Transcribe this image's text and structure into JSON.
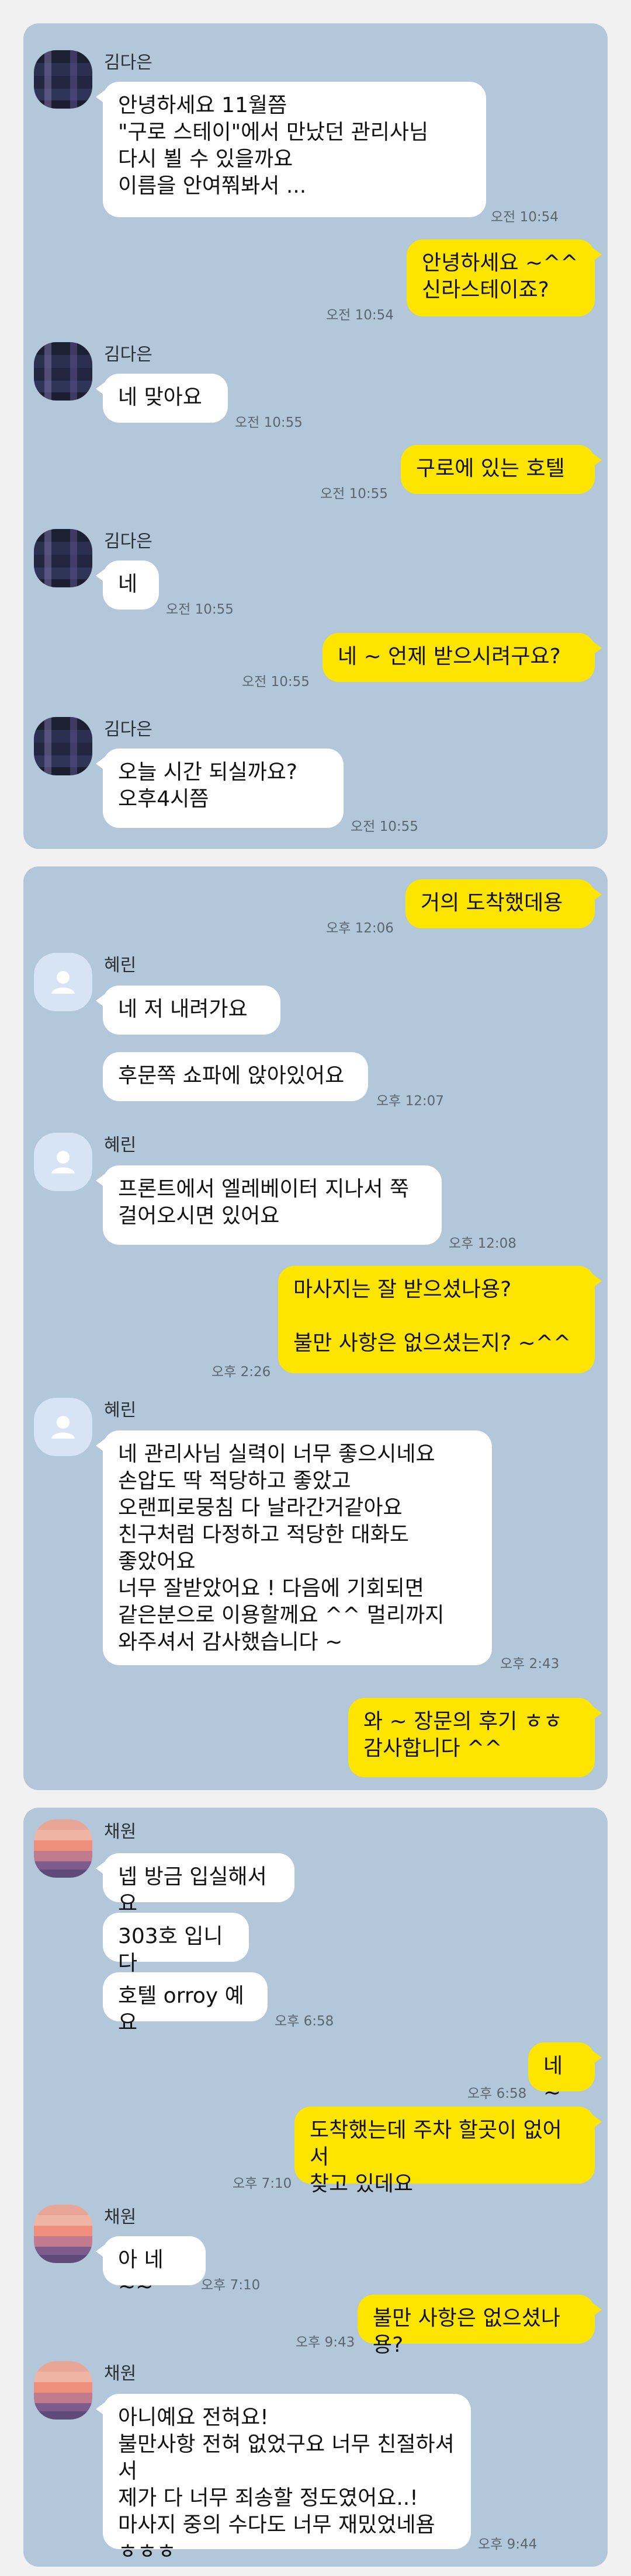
{
  "chat1": {
    "sender": "김다은",
    "m1_text": "안녕하세요 11월쯤\n\"구로 스테이\"에서 만났던 관리사님\n다시 뵐 수 있을까요\n이름을 안여쭤봐서 ...",
    "m1_time": "오전 10:54",
    "m2_text": "안녕하세요 ~^^\n신라스테이죠?",
    "m2_time": "오전 10:54",
    "m3_text": "네 맞아요",
    "m3_time": "오전 10:55",
    "m4_text": "구로에 있는 호텔",
    "m4_time": "오전 10:55",
    "m5_text": "네",
    "m5_time": "오전 10:55",
    "m6_text": "네 ~ 언제 받으시려구요?",
    "m6_time": "오전 10:55",
    "m7_text": "오늘  시간 되실까요?\n오후4시쯤",
    "m7_time": "오전 10:55"
  },
  "chat2": {
    "sender": "혜린",
    "m1_text": "거의 도착했데용",
    "m1_time": "오후 12:06",
    "m2_text": "네 저 내려가요",
    "m3_text": "후문쪽 쇼파에 앉아있어요",
    "m3_time": "오후 12:07",
    "m4_text": "프론트에서 엘레베이터 지나서 쭉\n걸어오시면 있어요",
    "m4_time": "오후 12:08",
    "m5_text": "마사지는 잘 받으셨나용?\n\n불만 사항은 없으셨는지? ~^^",
    "m5_time": "오후 2:26",
    "m6_text": "네 관리사님 실력이 너무 좋으시네요\n손압도 딱 적당하고 좋았고\n오랜피로뭉침 다 날라간거같아요\n친구처럼 다정하고 적당한 대화도\n좋았어요\n너무 잘받았어요 ! 다음에 기회되면\n같은분으로 이용할께요 ^^ 멀리까지\n와주셔서 감사했습니다 ~",
    "m6_time": "오후 2:43",
    "m7_text": "와 ~ 장문의 후기 ㅎㅎ\n감사합니다 ^^"
  },
  "chat3": {
    "sender": "채원",
    "m1_text": "넵 방금 입실해서요",
    "m2_text": "303호 입니다",
    "m3_text": "호텔 orroy 예요",
    "m3_time": "오후 6:58",
    "m4_text": "네 ~",
    "m4_time": "오후 6:58",
    "m5_text": "도착했는데  주차 할곳이 없어서\n찾고 있데요",
    "m5_time": "오후 7:10",
    "m6_text": "아 네~~",
    "m6_time": "오후 7:10",
    "m7_text": "불만 사항은 없으셨나용?",
    "m7_time": "오후 9:43",
    "m8_text": "아니예요 전혀요!\n불만사항 전혀 없었구요 너무 친절하셔서\n제가 다 너무 죄송할 정도였어요..!\n마사지 중의 수다도 너무 재밌었네욤\nㅎㅎㅎ",
    "m8_time": "오후 9:44"
  },
  "colors": {
    "panel_bg": "#b2c7d9",
    "incoming_bubble": "#ffffff",
    "outgoing_bubble": "#fee500"
  },
  "icons": {
    "default_avatar": "person-silhouette-icon"
  }
}
